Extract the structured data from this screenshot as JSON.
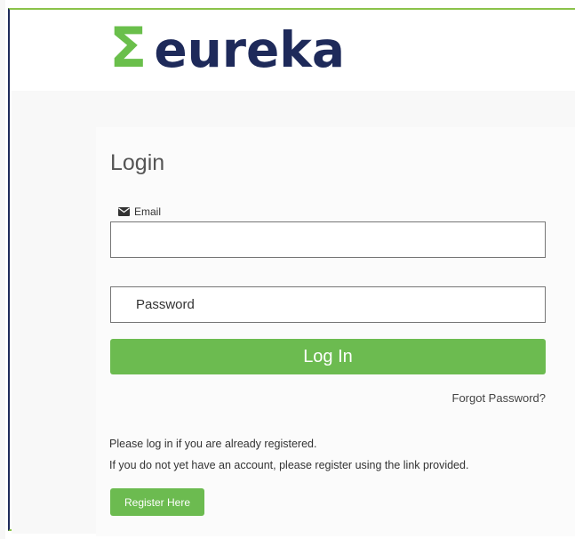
{
  "brand": {
    "sigma": "Σ",
    "name": "eureka"
  },
  "login": {
    "title": "Login",
    "email_label": "Email",
    "email_value": "",
    "password_placeholder": "Password",
    "submit_label": "Log In",
    "forgot_label": "Forgot Password?"
  },
  "info": {
    "line1": "Please log in if you are already registered.",
    "line2": "If you do not yet have an account, please register using the link provided."
  },
  "register": {
    "label": "Register Here"
  },
  "colors": {
    "accent": "#6cbb50",
    "brand_navy": "#1e2a5a",
    "brand_green": "#6abf4b"
  },
  "icons": {
    "email": "envelope-icon",
    "password": "key-icon"
  }
}
